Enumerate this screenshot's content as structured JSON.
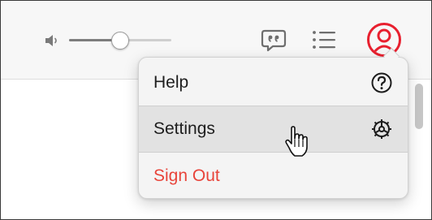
{
  "toolbar": {
    "volume": {
      "icon": "speaker-icon",
      "level": 0.5
    },
    "lyrics_icon": "lyrics-speech-bubble-icon",
    "queue_icon": "list-icon",
    "account_icon": "person-circle-icon"
  },
  "account_menu": {
    "items": [
      {
        "label": "Help",
        "icon": "question-circle-icon",
        "color": "#1d1d1d"
      },
      {
        "label": "Settings",
        "icon": "gear-icon",
        "color": "#1d1d1d",
        "highlighted": true
      },
      {
        "label": "Sign Out",
        "color": "#e8443a"
      }
    ]
  },
  "colors": {
    "accent": "#e8202f",
    "danger_text": "#e8443a",
    "toolbar_bg": "#f7f7f7",
    "menu_bg": "#f4f4f4",
    "highlight_bg": "#e2e2e2"
  },
  "cursor": "pointing-hand-cursor"
}
